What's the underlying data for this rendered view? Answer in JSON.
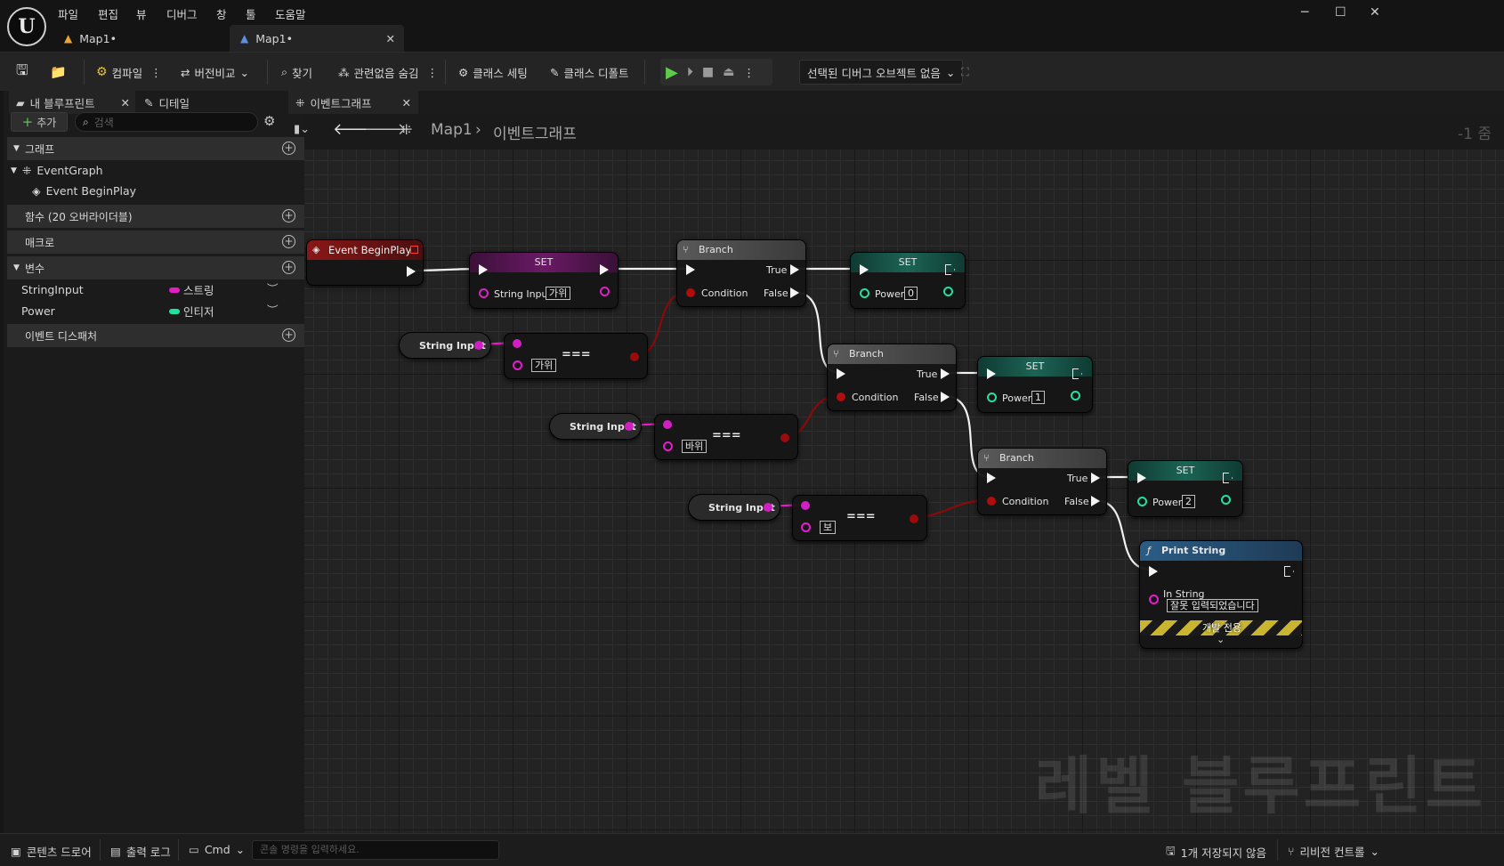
{
  "menu": [
    "파일",
    "편집",
    "뷰",
    "디버그",
    "창",
    "툴",
    "도움말"
  ],
  "tabs": [
    {
      "label": "Map1•"
    },
    {
      "label": "Map1•"
    }
  ],
  "toolbar": {
    "compile": "컴파일",
    "diff": "버전비교",
    "find": "찾기",
    "hide_unrelated": "관련없음 숨김",
    "class_settings": "클래스 세팅",
    "class_defaults": "클래스 디폴트",
    "debug_object": "선택된 디버그 오브젝트 없음"
  },
  "left_panel": {
    "tab_blueprint": "내 블루프린트",
    "tab_details": "디테일",
    "add_label": "추가",
    "search_placeholder": "검색",
    "sec_graph": "그래프",
    "event_graph": "EventGraph",
    "event_begin": "Event BeginPlay",
    "sec_functions": "함수 (20 오버라이더블)",
    "sec_macros": "매크로",
    "sec_variables": "변수",
    "variables": [
      {
        "name": "StringInput",
        "type": "스트링",
        "color": "#e31fc4"
      },
      {
        "name": "Power",
        "type": "인티저",
        "color": "#1fe2a2"
      }
    ],
    "sec_dispatchers": "이벤트 디스패처"
  },
  "graph": {
    "tab_label": "이벤트그래프",
    "breadcrumb_root": "Map1",
    "breadcrumb_leaf": "이벤트그래프",
    "zoom": "-1 줌",
    "watermark": "레벨 블루프린트",
    "nodes": {
      "event_begin": "Event BeginPlay",
      "set": "SET",
      "string_input": "String Input",
      "set_string_value": "가위",
      "branch": "Branch",
      "true": "True",
      "false": "False",
      "condition": "Condition",
      "power": "Power",
      "eq": "===",
      "cmp_values": [
        "가위",
        "바위",
        "보"
      ],
      "power_values": [
        "0",
        "1",
        "2"
      ],
      "print_string": "Print String",
      "in_string": "In String",
      "print_value": "잘못 입력되었습니다",
      "dev_only": "개발 전용"
    }
  },
  "status": {
    "content_drawer": "콘텐츠 드로어",
    "output_log": "출력 로그",
    "cmd": "Cmd",
    "cmd_placeholder": "콘솔 명령을 입력하세요.",
    "unsaved": "1개 저장되지 않음",
    "revision": "리비전 컨트롤"
  }
}
